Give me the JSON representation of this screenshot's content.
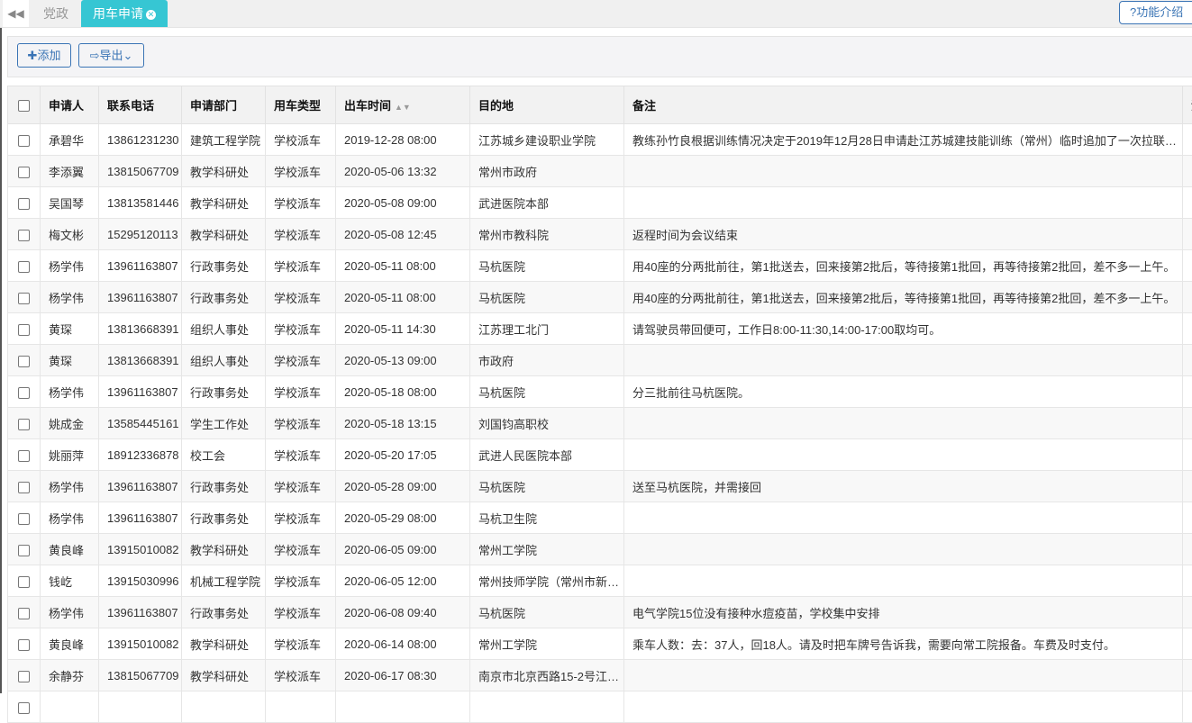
{
  "tabs": {
    "back_icon": "double-chevron-left",
    "items": [
      {
        "label": "党政"
      },
      {
        "label": "用车申请",
        "active": true
      }
    ],
    "help_label": "?功能介绍"
  },
  "toolbar": {
    "add_label": "✚添加",
    "export_label": "⇨导出⌄"
  },
  "table": {
    "columns": [
      "申请人",
      "联系电话",
      "申请部门",
      "用车类型",
      "出车时间",
      "目的地",
      "备注",
      "流"
    ],
    "rows": [
      [
        "承碧华",
        "13861231230",
        "建筑工程学院",
        "学校派车",
        "2019-12-28 08:00",
        "江苏城乡建设职业学院",
        "教练孙竹良根据训练情况决定于2019年12月28日申请赴江苏城建技能训练（常州）临时追加了一次拉联…"
      ],
      [
        "李添翼",
        "13815067709",
        "教学科研处",
        "学校派车",
        "2020-05-06 13:32",
        "常州市政府",
        ""
      ],
      [
        "吴国琴",
        "13813581446",
        "教学科研处",
        "学校派车",
        "2020-05-08 09:00",
        "武进医院本部",
        ""
      ],
      [
        "梅文彬",
        "15295120113",
        "教学科研处",
        "学校派车",
        "2020-05-08 12:45",
        "常州市教科院",
        "返程时间为会议结束"
      ],
      [
        "杨学伟",
        "13961163807",
        "行政事务处",
        "学校派车",
        "2020-05-11 08:00",
        "马杭医院",
        "用40座的分两批前往，第1批送去，回来接第2批后，等待接第1批回，再等待接第2批回，差不多一上午。"
      ],
      [
        "杨学伟",
        "13961163807",
        "行政事务处",
        "学校派车",
        "2020-05-11 08:00",
        "马杭医院",
        "用40座的分两批前往，第1批送去，回来接第2批后，等待接第1批回，再等待接第2批回，差不多一上午。"
      ],
      [
        "黄琛",
        "13813668391",
        "组织人事处",
        "学校派车",
        "2020-05-11 14:30",
        "江苏理工北门",
        "请驾驶员带回便可，工作日8:00-11:30,14:00-17:00取均可。"
      ],
      [
        "黄琛",
        "13813668391",
        "组织人事处",
        "学校派车",
        "2020-05-13 09:00",
        "市政府",
        ""
      ],
      [
        "杨学伟",
        "13961163807",
        "行政事务处",
        "学校派车",
        "2020-05-18 08:00",
        "马杭医院",
        "分三批前往马杭医院。"
      ],
      [
        "姚成金",
        "13585445161",
        "学生工作处",
        "学校派车",
        "2020-05-18 13:15",
        "刘国钧高职校",
        ""
      ],
      [
        "姚丽萍",
        "18912336878",
        "校工会",
        "学校派车",
        "2020-05-20 17:05",
        "武进人民医院本部",
        ""
      ],
      [
        "杨学伟",
        "13961163807",
        "行政事务处",
        "学校派车",
        "2020-05-28 09:00",
        "马杭医院",
        "送至马杭医院，并需接回"
      ],
      [
        "杨学伟",
        "13961163807",
        "行政事务处",
        "学校派车",
        "2020-05-29 08:00",
        "马杭卫生院",
        ""
      ],
      [
        "黄良峰",
        "13915010082",
        "教学科研处",
        "学校派车",
        "2020-06-05 09:00",
        "常州工学院",
        ""
      ],
      [
        "钱屹",
        "13915030996",
        "机械工程学院",
        "学校派车",
        "2020-06-05 12:00",
        "常州技师学院（常州市新…",
        ""
      ],
      [
        "杨学伟",
        "13961163807",
        "行政事务处",
        "学校派车",
        "2020-06-08 09:40",
        "马杭医院",
        "电气学院15位没有接种水痘疫苗，学校集中安排"
      ],
      [
        "黄良峰",
        "13915010082",
        "教学科研处",
        "学校派车",
        "2020-06-14 08:00",
        "常州工学院",
        "乘车人数：去：37人，回18人。请及时把车牌号告诉我，需要向常工院报备。车费及时支付。"
      ],
      [
        "余静芬",
        "13815067709",
        "教学科研处",
        "学校派车",
        "2020-06-17 08:30",
        "南京市北京西路15-2号江…",
        ""
      ],
      [
        "",
        "",
        "",
        "",
        "",
        "",
        ""
      ]
    ]
  }
}
